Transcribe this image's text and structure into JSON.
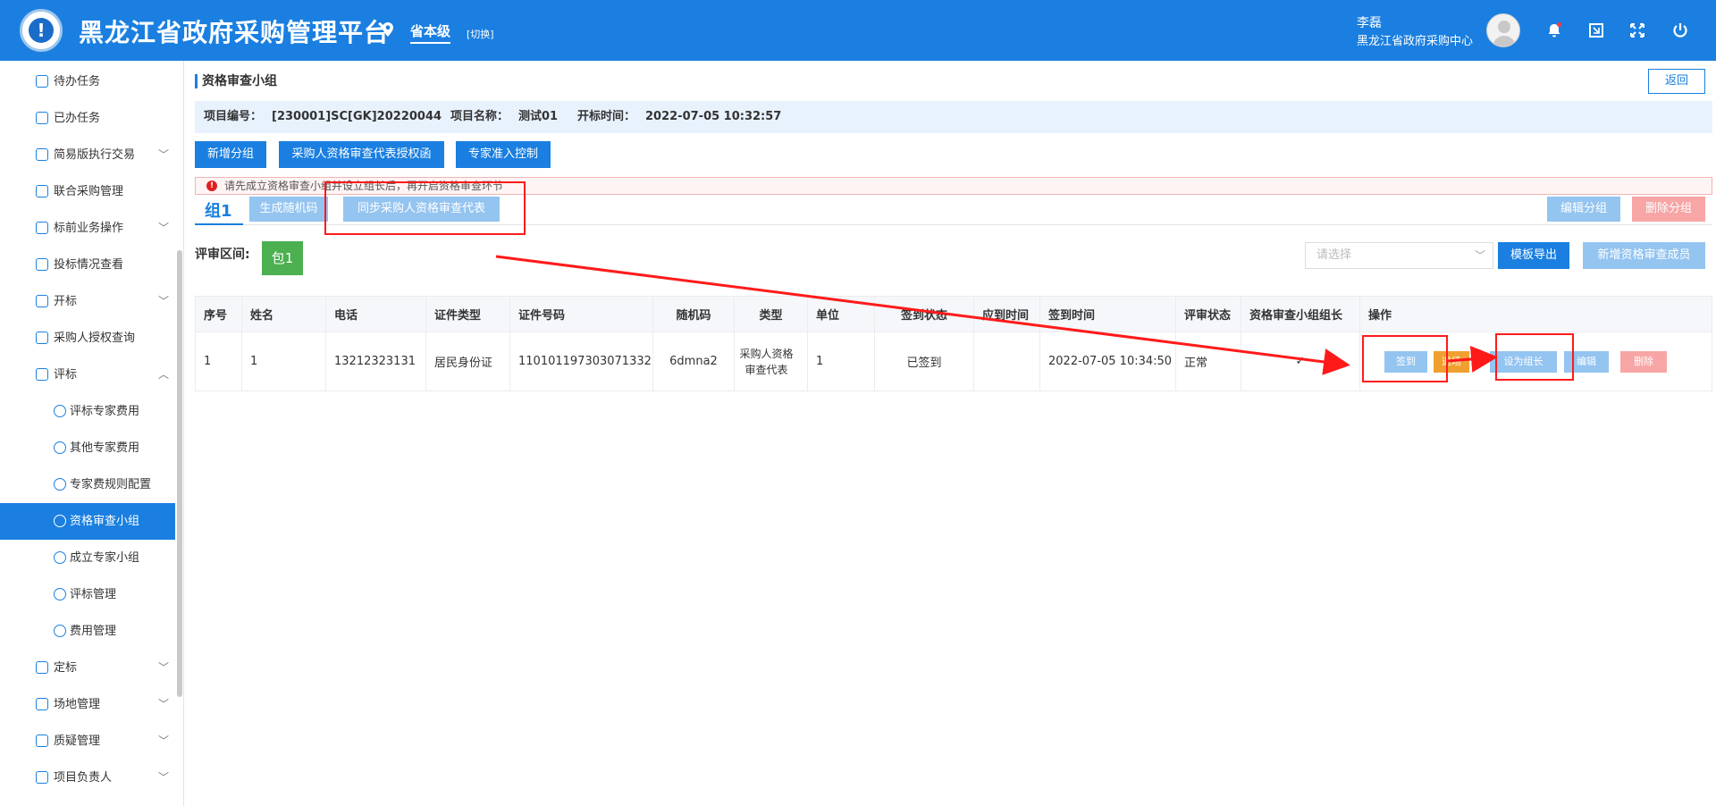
{
  "header": {
    "app_title": "黑龙江省政府采购管理平台",
    "level": "省本级",
    "switch_label": "[切换]",
    "user_name": "李磊",
    "user_org": "黑龙江省政府采购中心",
    "brand_color": "#1a7fe0"
  },
  "sidebar": {
    "items": [
      {
        "label": "待办任务",
        "icon": "task-icon"
      },
      {
        "label": "已办任务",
        "icon": "done-task-icon"
      },
      {
        "label": "简易版执行交易",
        "icon": "exec-icon",
        "arrow": "﹀"
      },
      {
        "label": "联合采购管理",
        "icon": "joint-icon"
      },
      {
        "label": "标前业务操作",
        "icon": "cart-icon",
        "arrow": "﹀"
      },
      {
        "label": "投标情况查看",
        "icon": "bid-icon"
      },
      {
        "label": "开标",
        "icon": "open-icon",
        "arrow": "﹀"
      },
      {
        "label": "采购人授权查询",
        "icon": "shield-icon"
      },
      {
        "label": "评标",
        "icon": "eval-icon",
        "arrow": "︿"
      },
      {
        "label": "评标专家费用",
        "icon": "yen-icon"
      },
      {
        "label": "其他专家费用",
        "icon": "yen-icon"
      },
      {
        "label": "专家费规则配置",
        "icon": "yen-icon"
      },
      {
        "label": "资格审查小组",
        "icon": "user-icon"
      },
      {
        "label": "成立专家小组",
        "icon": "user-icon"
      },
      {
        "label": "评标管理",
        "icon": "layers-icon"
      },
      {
        "label": "费用管理",
        "icon": "send-icon"
      },
      {
        "label": "定标",
        "icon": "award-icon",
        "arrow": "﹀"
      },
      {
        "label": "场地管理",
        "icon": "venue-icon",
        "arrow": "﹀"
      },
      {
        "label": "质疑管理",
        "icon": "cart-icon",
        "arrow": "﹀"
      },
      {
        "label": "项目负责人",
        "icon": "person-icon",
        "arrow": "﹀"
      }
    ]
  },
  "main": {
    "title": "资格审查小组",
    "back_label": "返回",
    "info": {
      "project_no_label": "项目编号：",
      "project_no": "[230001]SC[GK]20220044",
      "project_name_label": "项目名称：",
      "project_name": "测试01",
      "open_time_label": "开标时间：",
      "open_time": "2022-07-05 10:32:57"
    },
    "toolbar": {
      "add_group": "新增分组",
      "auth_letter": "采购人资格审查代表授权函",
      "expert_control": "专家准入控制"
    },
    "alert_text": "请先成立资格审查小组并设立组长后，再开启资格审查环节",
    "group_tab": "组1",
    "gen_random": "生成随机码",
    "sync_rep": "同步采购人资格审查代表",
    "edit_group": "编辑分组",
    "delete_group": "删除分组",
    "review_label": "评审区间:",
    "package": "包1",
    "select_placeholder": "请选择",
    "export_template": "模板导出",
    "add_member": "新增资格审查成员",
    "table": {
      "headers": [
        "序号",
        "姓名",
        "电话",
        "证件类型",
        "证件号码",
        "随机码",
        "类型",
        "单位",
        "签到状态",
        "应到时间",
        "签到时间",
        "评审状态",
        "资格审查小组组长",
        "操作"
      ],
      "rows": [
        {
          "no": "1",
          "name": "1",
          "phone": "13212323131",
          "id_type": "居民身份证",
          "id_no": "110101197303071332",
          "random": "6dmna2",
          "type": "采购人资格审查代表",
          "unit": "1",
          "sign_status": "已签到",
          "due_time": "",
          "sign_time": "2022-07-05 10:34:50",
          "review_status": "正常",
          "leader": "✓"
        }
      ],
      "ops": {
        "sign": "签到",
        "exit": "退场",
        "set_leader": "设为组长",
        "edit": "编辑",
        "delete": "删除"
      }
    }
  }
}
